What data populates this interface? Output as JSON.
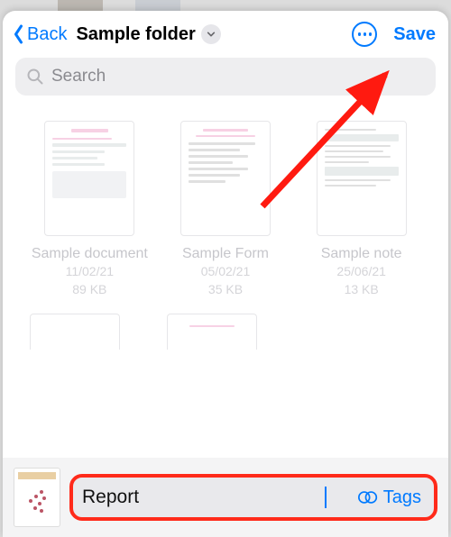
{
  "nav": {
    "back_label": "Back",
    "title": "Sample folder",
    "save_label": "Save"
  },
  "search": {
    "placeholder": "Search"
  },
  "files": [
    {
      "name": "Sample document",
      "date": "11/02/21",
      "size": "89 KB"
    },
    {
      "name": "Sample Form",
      "date": "05/02/21",
      "size": "35 KB"
    },
    {
      "name": "Sample note",
      "date": "25/06/21",
      "size": "13 KB"
    }
  ],
  "filename_input": {
    "value": "Report",
    "tags_label": "Tags"
  },
  "colors": {
    "accent": "#007aff",
    "highlight_border": "#ff2a1a"
  }
}
